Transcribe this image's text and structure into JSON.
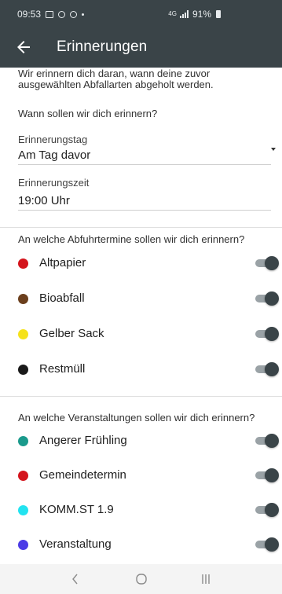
{
  "status_bar": {
    "time": "09:53",
    "signal": "4G",
    "battery": "91%"
  },
  "app_bar": {
    "title": "Erinnerungen",
    "back_icon": "arrow-back-icon"
  },
  "intro_text": "Wir erinnern dich daran, wann deine zuvor ausgewählten Abfallarten abgeholt werden.",
  "reminder_question": "Wann sollen wir dich erinnern?",
  "reminder_day": {
    "label": "Erinnerungstag",
    "value": "Am Tag davor"
  },
  "reminder_time": {
    "label": "Erinnerungszeit",
    "value": "19:00 Uhr"
  },
  "waste_section": {
    "heading": "An welche Abfuhrtermine sollen wir dich erinnern?",
    "items": [
      {
        "label": "Altpapier",
        "color": "#d4141c",
        "enabled": true
      },
      {
        "label": "Bioabfall",
        "color": "#6b3f1d",
        "enabled": true
      },
      {
        "label": "Gelber Sack",
        "color": "#f5e21b",
        "enabled": true
      },
      {
        "label": "Restmüll",
        "color": "#1a1a1a",
        "enabled": true
      }
    ]
  },
  "events_section": {
    "heading": "An welche Veranstaltungen sollen wir dich erinnern?",
    "items": [
      {
        "label": "Angerer Frühling",
        "color": "#1a9a8c",
        "enabled": true
      },
      {
        "label": "Gemeindetermin",
        "color": "#d4141c",
        "enabled": true
      },
      {
        "label": "KOMM.ST 1.9",
        "color": "#22e3f0",
        "enabled": true
      },
      {
        "label": "Veranstaltung",
        "color": "#4b3be6",
        "enabled": true
      }
    ]
  },
  "nav_bar": {
    "recents_icon": "recents-icon",
    "home_icon": "home-icon",
    "back_icon": "nav-back-icon"
  }
}
